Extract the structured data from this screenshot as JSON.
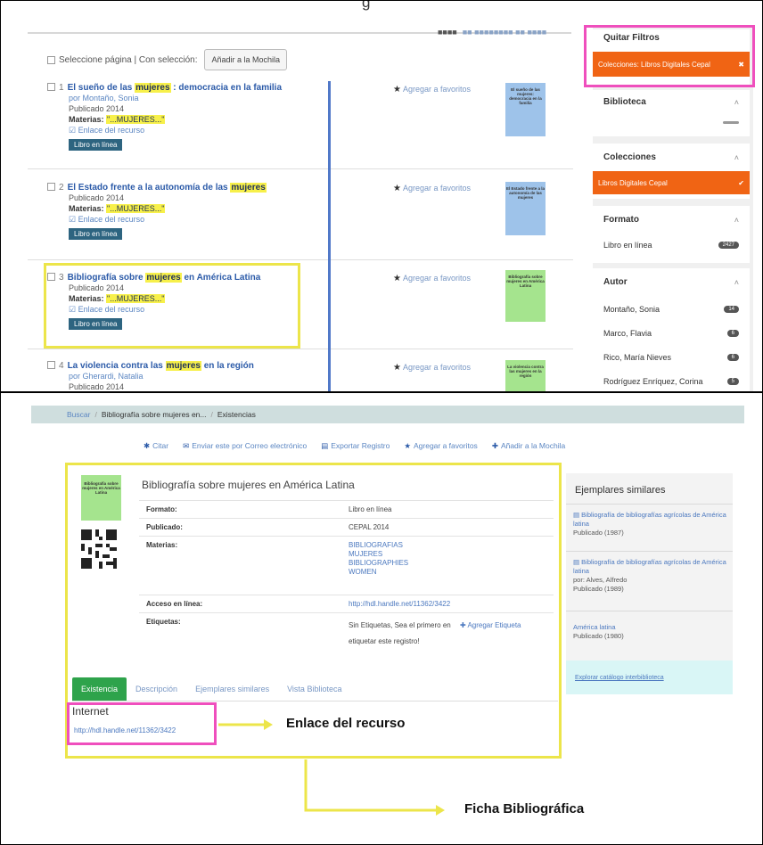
{
  "top": {
    "cut_title": "g",
    "sort_fragment": {
      "label": "■■■■",
      "options": "■■ ■■■■■■■■ ■■ ■■■■"
    },
    "select_page": "Seleccione página | Con selección:",
    "add_mochila": "Añadir a la Mochila",
    "favorites_label": "Agregar a favoritos",
    "results": [
      {
        "num": "1",
        "title_pre": "El sueño de las",
        "title_hl": "mujeres",
        "title_post": ": democracia en la familia",
        "by": "por Montaño, Sonia",
        "published": "Publicado 2014",
        "materias_pre": "Materias:",
        "materias_val": "\"...MUJERES...\"",
        "link": "Enlace del recurso",
        "badge": "Libro en línea",
        "cover_text": "El sueño de las mujeres: democracia en la familia"
      },
      {
        "num": "2",
        "title_pre": "El Estado frente a la autonomía de las",
        "title_hl": "mujeres",
        "title_post": "",
        "published": "Publicado 2014",
        "materias_pre": "Materias:",
        "materias_val": "\"...MUJERES...\"",
        "link": "Enlace del recurso",
        "badge": "Libro en línea",
        "cover_text": "El Estado frente a la autonomía de las mujeres"
      },
      {
        "num": "3",
        "title_pre": "Bibliografía sobre",
        "title_hl": "mujeres",
        "title_post": "en América Latina",
        "published": "Publicado 2014",
        "materias_pre": "Materias:",
        "materias_val": "\"...MUJERES...\"",
        "link": "Enlace del recurso",
        "badge": "Libro en línea",
        "cover_text": "Bibliografía sobre mujeres en América Latina"
      },
      {
        "num": "4",
        "title_pre": "La violencia contra las",
        "title_hl": "mujeres",
        "title_post": "en la región",
        "by": "por Gherardi, Natalia",
        "published": "Publicado 2014",
        "cover_text": "La violencia contra las mujeres en la región"
      }
    ],
    "facets": {
      "remove_filters": "Quitar Filtros",
      "active_filter": "Colecciones: Libros Digitales Cepal",
      "biblioteca": "Biblioteca",
      "colecciones": "Colecciones",
      "coleccion_item": "Libros Digitales Cepal",
      "formato": "Formato",
      "formato_item": "Libro en línea",
      "formato_count": "2427",
      "autor": "Autor",
      "autores": [
        {
          "name": "Montaño, Sonia",
          "count": "14"
        },
        {
          "name": "Marco, Flavia",
          "count": "6"
        },
        {
          "name": "Rico, María Nieves",
          "count": "6"
        },
        {
          "name": "Rodríguez Enríquez, Corina",
          "count": "5"
        }
      ]
    }
  },
  "bottom": {
    "breadcrumb": {
      "home": "Buscar",
      "record": "Bibliografía sobre mujeres en...",
      "current": "Existencias"
    },
    "toolbar": [
      "Citar",
      "Enviar este por Correo electrónico",
      "Exportar Registro",
      "Agregar a favoritos",
      "Añadir a la Mochila"
    ],
    "record": {
      "cover_text": "Bibliografía sobre mujeres en América Latina",
      "title": "Bibliografía sobre mujeres en América Latina",
      "fields": {
        "formato_k": "Formato:",
        "formato_v": "Libro en línea",
        "publicado_k": "Publicado:",
        "publicado_v": "CEPAL 2014",
        "materias_k": "Materias:",
        "materias_v": [
          "BIBLIOGRAFIAS",
          "MUJERES",
          "BIBLIOGRAPHIES",
          "WOMEN"
        ],
        "acceso_k": "Acceso en línea:",
        "acceso_v": "http://hdl.handle.net/11362/3422",
        "etiquetas_k": "Etiquetas:",
        "etiquetas_v": "Sin Etiquetas, Sea el primero en",
        "etiquetas_add": "Agregar Etiqueta",
        "etiquetas_v2": "etiquetar este registro!"
      }
    },
    "tabs": [
      "Existencia",
      "Descripción",
      "Ejemplares similares",
      "Vista Biblioteca"
    ],
    "internet_label": "Internet",
    "internet_url": "http://hdl.handle.net/11362/3422",
    "annotation_link": "Enlace del recurso",
    "annotation_record": "Ficha Bibliográfica",
    "similar": {
      "heading": "Ejemplares similares",
      "items": [
        {
          "title": "Bibliografía de bibliografías agrícolas de América latina",
          "meta": "Publicado (1987)"
        },
        {
          "title": "Bibliografía de bibliografías agrícolas de América latina",
          "author": "por: Alves, Alfredo",
          "meta": "Publicado (1989)"
        },
        {
          "title": "América latina",
          "meta": "Publicado (1980)"
        }
      ],
      "footer": "Explorar catálogo interbiblioteca"
    },
    "colors": {
      "yellow": "#ece54a",
      "pink": "#ef4fbd",
      "orange": "#f06414",
      "green": "#2ea34b"
    }
  }
}
